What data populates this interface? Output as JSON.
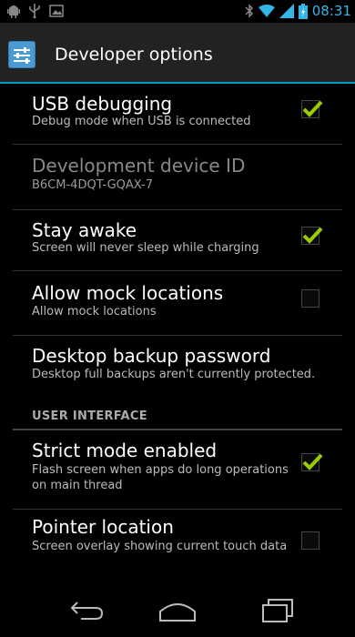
{
  "status_bar": {
    "time": "08:31",
    "icons": [
      "android-debug-icon",
      "usb-icon",
      "gallery-icon",
      "bluetooth-icon",
      "wifi-icon",
      "signal-icon",
      "battery-icon"
    ]
  },
  "action_bar": {
    "title": "Developer options",
    "icon": "developer-options-icon"
  },
  "settings": [
    {
      "title": "USB debugging",
      "summary": "Debug mode when USB is connected",
      "checkbox": true,
      "checked": true
    },
    {
      "title": "Development device ID",
      "summary": "B6CM-4DQT-GQAX-7",
      "checkbox": false,
      "enabled": false
    },
    {
      "title": "Stay awake",
      "summary": "Screen will never sleep while charging",
      "checkbox": true,
      "checked": true
    },
    {
      "title": "Allow mock locations",
      "summary": "Allow mock locations",
      "checkbox": true,
      "checked": false
    },
    {
      "title": "Desktop backup password",
      "summary": "Desktop full backups aren't currently protected.",
      "checkbox": false
    }
  ],
  "section_header": "USER INTERFACE",
  "ui_settings": [
    {
      "title": "Strict mode enabled",
      "summary": "Flash screen when apps do long operations on main thread",
      "checkbox": true,
      "checked": true
    },
    {
      "title": "Pointer location",
      "summary": "Screen overlay showing current touch data",
      "checkbox": true,
      "checked": false
    }
  ],
  "accent_color": "#33b5e5",
  "check_color": "#99cc00",
  "nav_bar": {
    "buttons": [
      "back-icon",
      "home-icon",
      "recent-apps-icon"
    ]
  }
}
